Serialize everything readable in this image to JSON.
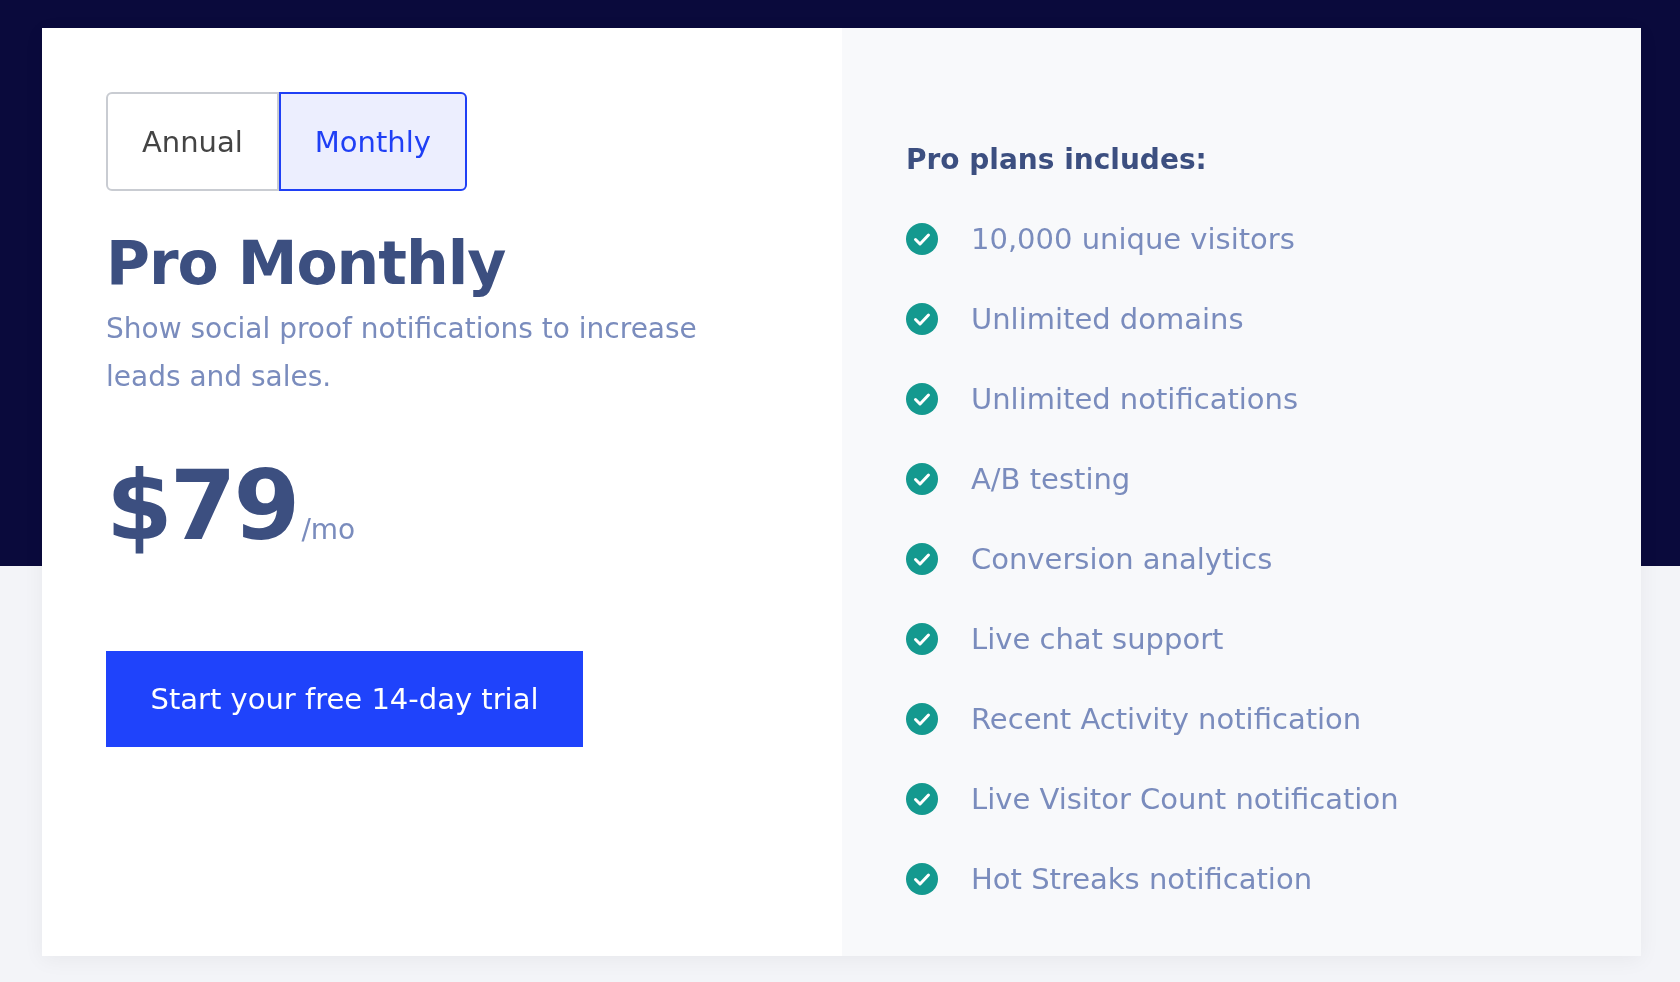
{
  "billing_toggle": [
    {
      "label": "Annual",
      "selected": false
    },
    {
      "label": "Monthly",
      "selected": true
    }
  ],
  "plan": {
    "title": "Pro Monthly",
    "description": "Show social proof notifications to increase leads and sales.",
    "price": "$79",
    "period": "/mo",
    "cta": "Start your free 14-day trial"
  },
  "features": {
    "heading": "Pro plans includes:",
    "items": [
      "10,000 unique visitors",
      "Unlimited domains",
      "Unlimited notifications",
      "A/B testing",
      "Conversion analytics",
      "Live chat support",
      "Recent Activity notification",
      "Live Visitor Count notification",
      "Hot Streaks notification"
    ]
  }
}
